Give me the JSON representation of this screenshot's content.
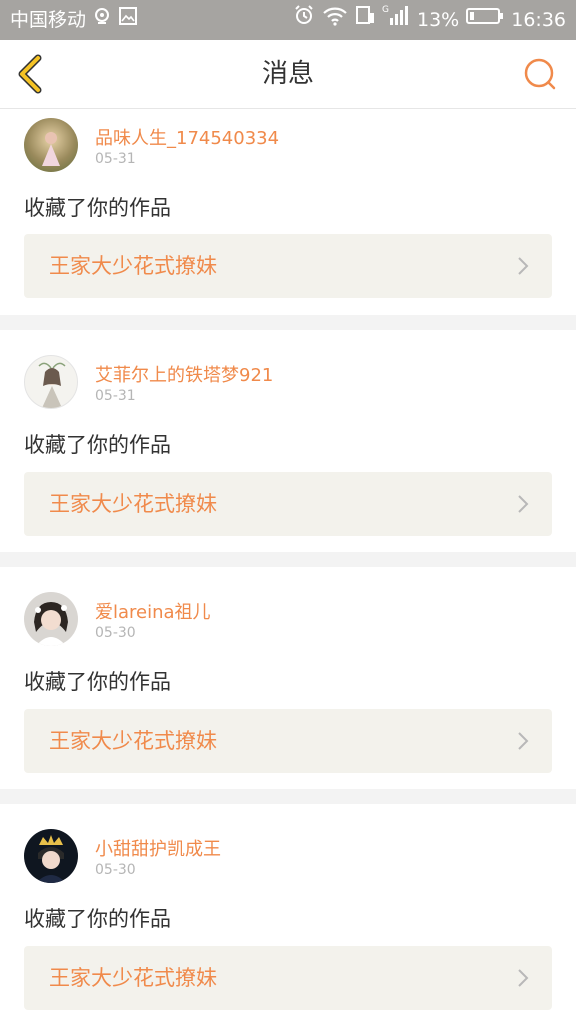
{
  "status_bar": {
    "carrier": "中国移动",
    "battery_percent": "13%",
    "time": "16:36",
    "network": "G"
  },
  "header": {
    "title": "消息"
  },
  "colors": {
    "accent": "#f08a4b",
    "back_arrow": "#f5c325",
    "status_bar_bg": "#a6a4a1"
  },
  "messages": [
    {
      "username": "品味人生_174540334",
      "date": "05-31",
      "action": "收藏了你的作品",
      "work_title": "王家大少花式撩妹"
    },
    {
      "username": "艾菲尔上的铁塔梦921",
      "date": "05-31",
      "action": "收藏了你的作品",
      "work_title": "王家大少花式撩妹"
    },
    {
      "username": "爱lareina祖儿",
      "date": "05-30",
      "action": "收藏了你的作品",
      "work_title": "王家大少花式撩妹"
    },
    {
      "username": "小甜甜护凯成王",
      "date": "05-30",
      "action": "收藏了你的作品",
      "work_title": "王家大少花式撩妹"
    }
  ]
}
